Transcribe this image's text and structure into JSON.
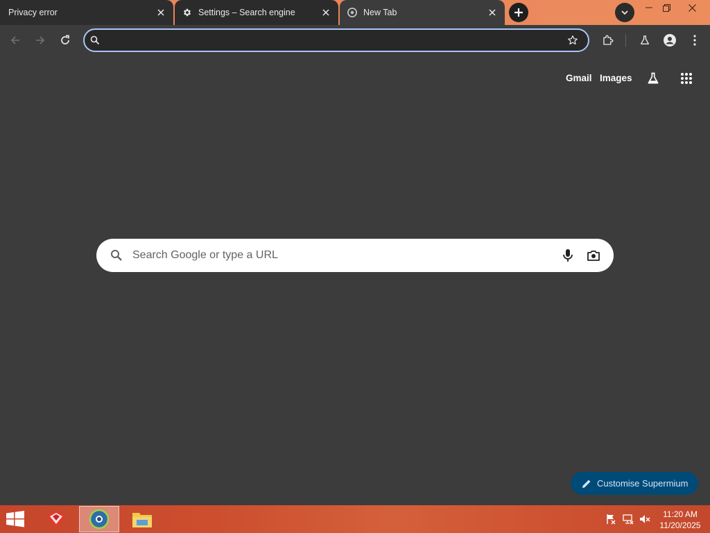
{
  "tabs": [
    {
      "title": "Privacy error",
      "favicon": "none"
    },
    {
      "title": "Settings – Search engine",
      "favicon": "gear-icon"
    },
    {
      "title": "New Tab",
      "favicon": "chromium-icon"
    }
  ],
  "omnibox": {
    "value": "",
    "placeholder": ""
  },
  "ntp": {
    "gmail_label": "Gmail",
    "images_label": "Images",
    "search_placeholder": "Search Google or type a URL",
    "customise_label": "Customise Supermium"
  },
  "taskbar": {
    "time": "11:20 AM",
    "date": "11/20/2025"
  },
  "colors": {
    "tabstrip": "#e9855a",
    "page_background": "#3c3c3c",
    "customise_button": "#004a77",
    "omnibox_focus_ring": "#a8c7fa",
    "taskbar": "#c94c2e"
  }
}
